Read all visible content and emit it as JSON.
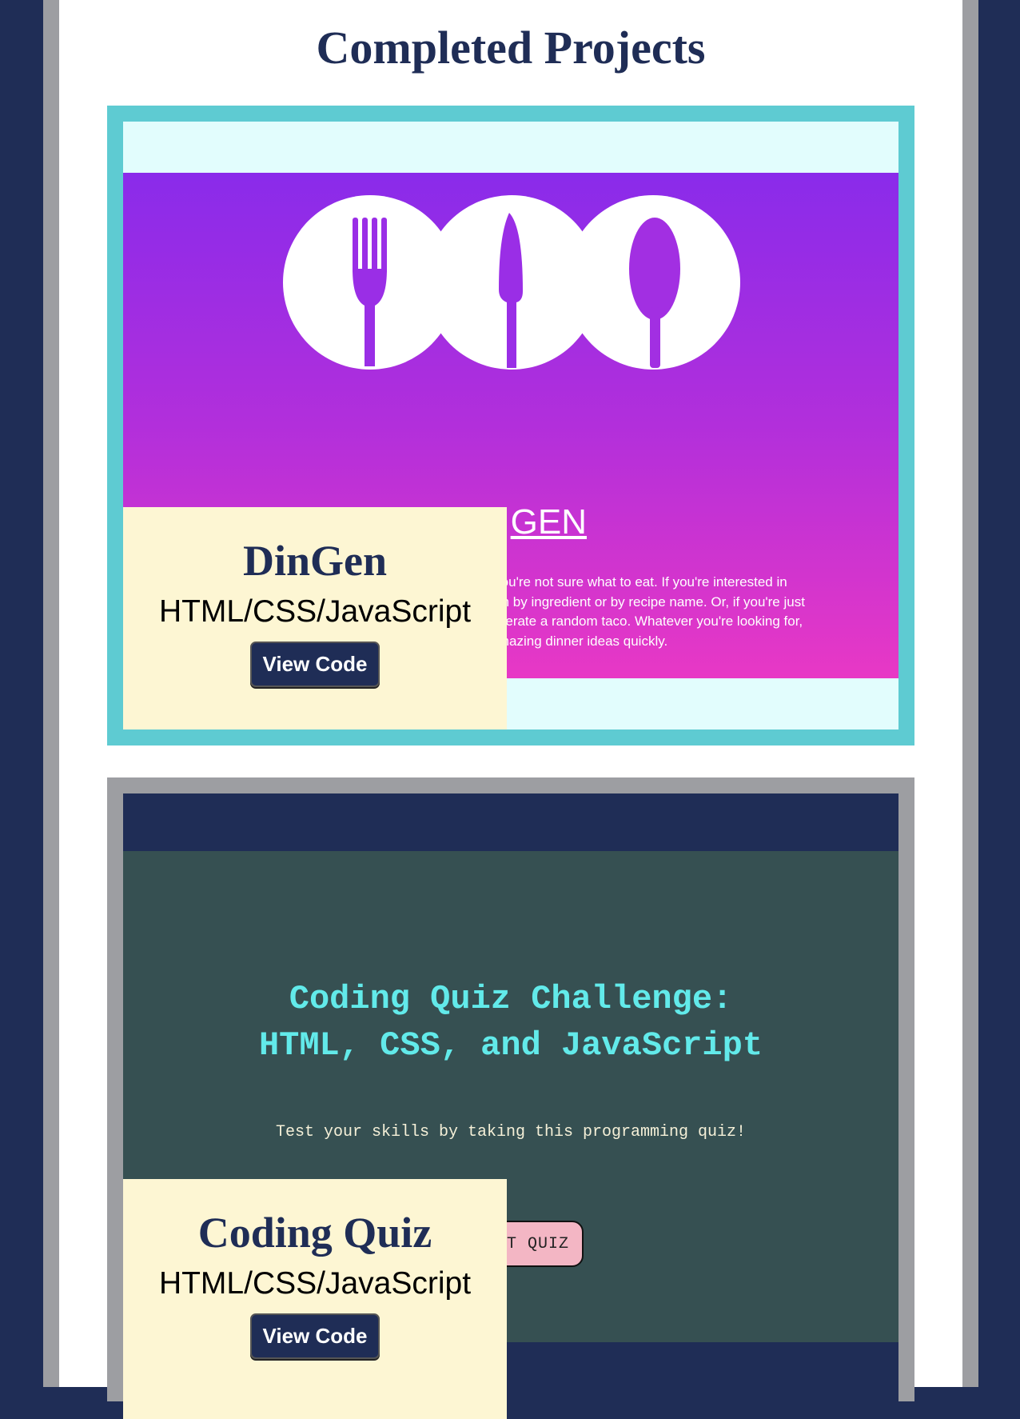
{
  "page": {
    "title": "Completed Projects"
  },
  "colors": {
    "navy": "#1f2d56",
    "teal_border": "#5ecbd2",
    "gray_border": "#9d9ea2",
    "cream": "#fdf6d3",
    "dingen_gradient_top": "#8a2bea",
    "dingen_gradient_bottom": "#e838c5",
    "quiz_background": "#365052",
    "quiz_heading": "#62eaea",
    "quiz_button": "#f3b6c4"
  },
  "projects": [
    {
      "name": "DinGen",
      "tech": "HTML/CSS/JavaScript",
      "button_label": "View Code",
      "screenshot": {
        "logo_icons": [
          "fork-icon",
          "knife-icon",
          "spoon-icon"
        ],
        "heading_partial": "GEN",
        "description_lines": [
          "n you're not sure what to eat. If you're interested in",
          "arch by ingredient or by recipe name. Or, if you're just",
          "generate a random taco. Whatever you're looking for,",
          ", amazing dinner ideas quickly."
        ]
      }
    },
    {
      "name": "Coding Quiz",
      "tech": "HTML/CSS/JavaScript",
      "button_label": "View Code",
      "screenshot": {
        "heading_line1": "Coding Quiz Challenge:",
        "heading_line2": "HTML, CSS, and JavaScript",
        "subtitle": "Test your skills by taking this programming quiz!",
        "button_partial": "T QUIZ"
      }
    }
  ]
}
